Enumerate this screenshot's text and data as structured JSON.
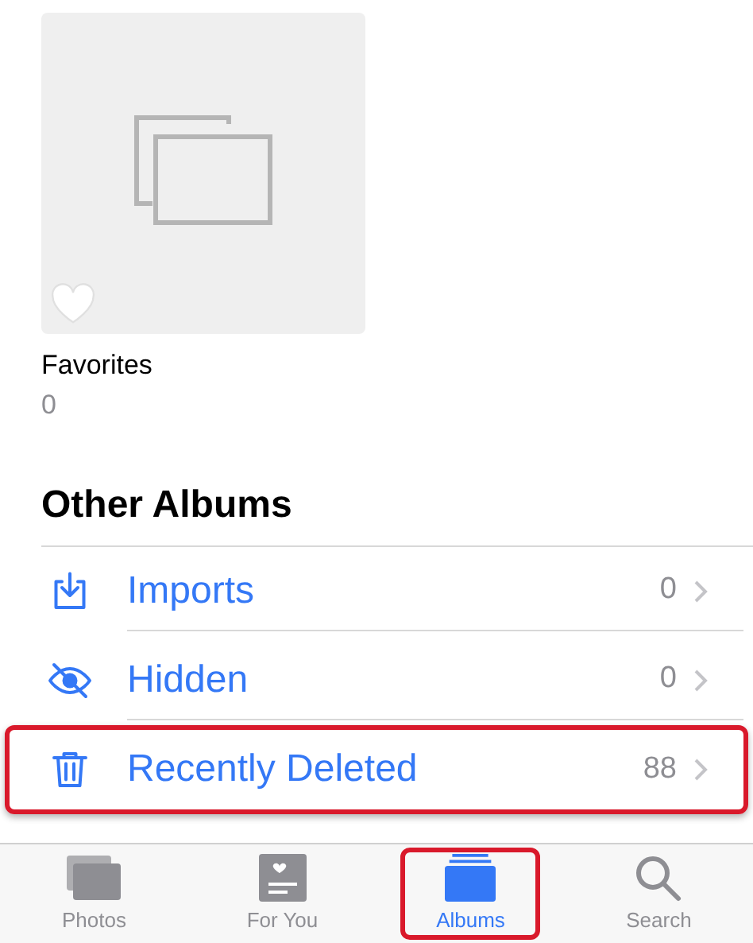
{
  "album": {
    "title": "Favorites",
    "count": "0"
  },
  "section": {
    "title": "Other Albums"
  },
  "rows": [
    {
      "kind": "import",
      "label": "Imports",
      "count": "0",
      "highlighted": false
    },
    {
      "kind": "hidden",
      "label": "Hidden",
      "count": "0",
      "highlighted": false
    },
    {
      "kind": "trash",
      "label": "Recently Deleted",
      "count": "88",
      "highlighted": true
    }
  ],
  "tabs": [
    {
      "kind": "photos",
      "label": "Photos",
      "selected": false,
      "highlighted": false
    },
    {
      "kind": "foryou",
      "label": "For You",
      "selected": false,
      "highlighted": false
    },
    {
      "kind": "albums",
      "label": "Albums",
      "selected": true,
      "highlighted": true
    },
    {
      "kind": "search",
      "label": "Search",
      "selected": false,
      "highlighted": false
    }
  ]
}
